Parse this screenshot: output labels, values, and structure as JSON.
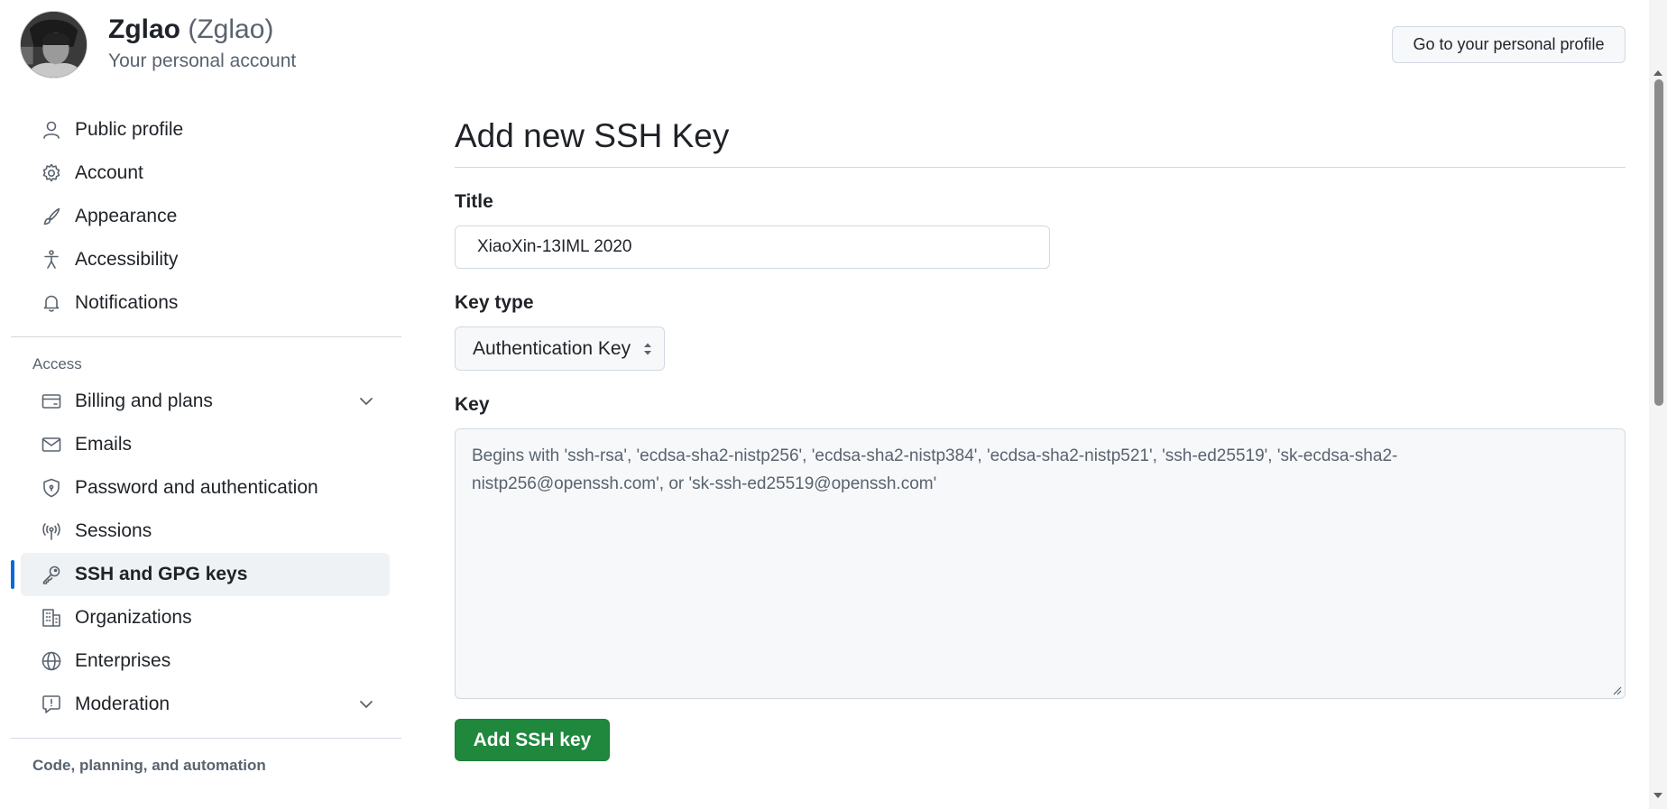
{
  "header": {
    "display_name": "Zglao",
    "login": "(Zglao)",
    "subtitle": "Your personal account",
    "profile_button": "Go to your personal profile"
  },
  "sidebar": {
    "items": [
      {
        "label": "Public profile",
        "icon": "person-icon"
      },
      {
        "label": "Account",
        "icon": "gear-icon"
      },
      {
        "label": "Appearance",
        "icon": "paintbrush-icon"
      },
      {
        "label": "Accessibility",
        "icon": "accessibility-icon"
      },
      {
        "label": "Notifications",
        "icon": "bell-icon"
      }
    ],
    "access_heading": "Access",
    "access_items": [
      {
        "label": "Billing and plans",
        "icon": "credit-card-icon",
        "expandable": true
      },
      {
        "label": "Emails",
        "icon": "mail-icon"
      },
      {
        "label": "Password and authentication",
        "icon": "shield-lock-icon"
      },
      {
        "label": "Sessions",
        "icon": "broadcast-icon"
      },
      {
        "label": "SSH and GPG keys",
        "icon": "key-icon",
        "active": true
      },
      {
        "label": "Organizations",
        "icon": "organization-icon"
      },
      {
        "label": "Enterprises",
        "icon": "globe-icon"
      },
      {
        "label": "Moderation",
        "icon": "report-icon",
        "expandable": true
      }
    ],
    "code_heading": "Code, planning, and automation"
  },
  "main": {
    "title": "Add new SSH Key",
    "title_label": "Title",
    "title_value": "XiaoXin-13IML 2020",
    "key_type_label": "Key type",
    "key_type_value": "Authentication Key",
    "key_label": "Key",
    "key_placeholder": "Begins with 'ssh-rsa', 'ecdsa-sha2-nistp256', 'ecdsa-sha2-nistp384', 'ecdsa-sha2-nistp521', 'ssh-ed25519', 'sk-ecdsa-sha2-nistp256@openssh.com', or 'sk-ssh-ed25519@openssh.com'",
    "submit_label": "Add SSH key"
  },
  "colors": {
    "accent": "#0969da",
    "primary_button": "#1f883d",
    "muted_text": "#59636e",
    "border": "#d1d9e0"
  }
}
